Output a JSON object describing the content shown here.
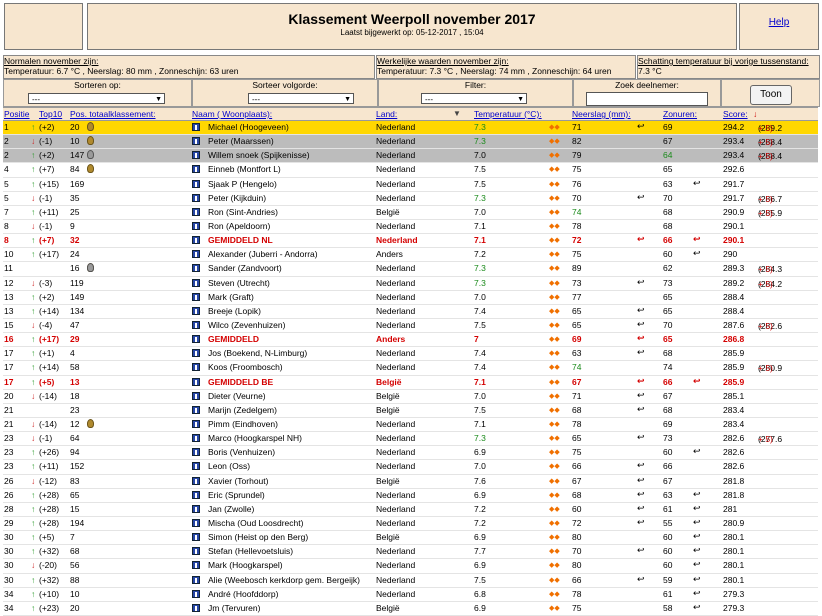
{
  "header": {
    "title": "Klassement Weerpoll november 2017",
    "updated": "Laatst bijgewerkt op: 05-12-2017 , 15:04",
    "help": "Help"
  },
  "info": {
    "normal_title": "Normalen november zijn:",
    "normal_values": "Temperatuur: 6.7 °C , Neerslag: 80 mm , Zonneschijn: 63 uren",
    "actual_title": "Werkelijke waarden november zijn:",
    "actual_values": "Temperatuur: 7.3 °C , Neerslag: 74 mm , Zonneschijn: 64 uren",
    "estimate_title": "Schatting temperatuur bij vorige tussenstand:",
    "estimate_value": "7.3 °C"
  },
  "controls": {
    "sort_on_label": "Sorteren op:",
    "sort_on_value": "---",
    "sort_order_label": "Sorteer volgorde:",
    "sort_order_value": "---",
    "filter_label": "Filter:",
    "filter_value": "---",
    "search_label": "Zoek deelnemer:",
    "search_value": "",
    "show_button": "Toon"
  },
  "columns": {
    "position": "Positie",
    "top10": "Top10",
    "total": "Pos. totaalklassement:",
    "name": "Naam ( Woonplaats):",
    "country": "Land:",
    "temperature": "Temperatuur (°C):",
    "precipitation": "Neerslag (mm):",
    "sun": "Zonuren:",
    "score": "Score:"
  },
  "colors": {
    "gold_row": "#ffd700",
    "silver_row": "#bcbcbc",
    "average_text": "#d40000",
    "good_value": "#1a8a1a",
    "panel": "#f7e6cf"
  },
  "rows": [
    {
      "rank": "1",
      "dir": "up",
      "move": "(+2)",
      "total": "20",
      "medals": [
        "gold"
      ],
      "name": "Michael (Hoogeveen)",
      "land": "Nederland",
      "temp": "7.3",
      "tg": true,
      "neer": "71",
      "ng": false,
      "nico": true,
      "zon": "69",
      "zg": false,
      "zico": false,
      "score": "294.2",
      "cmp": "(289.2 ",
      "plus": "+ 5)",
      "style": "gold"
    },
    {
      "rank": "2",
      "dir": "dn",
      "move": "(-1)",
      "total": "10",
      "medals": [
        "gold"
      ],
      "name": "Peter (Maarssen)",
      "land": "Nederland",
      "temp": "7.3",
      "tg": true,
      "neer": "82",
      "ng": false,
      "nico": false,
      "zon": "67",
      "zg": false,
      "zico": false,
      "score": "293.4",
      "cmp": "(288.4 ",
      "plus": "+ 5)",
      "style": "silver"
    },
    {
      "rank": "2",
      "dir": "up",
      "move": "(+2)",
      "total": "147",
      "medals": [
        "silver"
      ],
      "name": "Willem snoek (Spijkenisse)",
      "land": "Nederland",
      "temp": "7.0",
      "tg": false,
      "neer": "79",
      "ng": false,
      "nico": false,
      "zon": "64",
      "zg": true,
      "zico": false,
      "score": "293.4",
      "cmp": "(288.4 ",
      "plus": "+ 5)",
      "style": "silver"
    },
    {
      "rank": "4",
      "dir": "up",
      "move": "(+7)",
      "total": "84",
      "medals": [
        "gold"
      ],
      "name": "Einneb (Montfort L)",
      "land": "Nederland",
      "temp": "7.5",
      "tg": false,
      "neer": "75",
      "ng": false,
      "nico": false,
      "zon": "65",
      "zg": false,
      "zico": false,
      "score": "292.6",
      "cmp": "",
      "plus": "",
      "style": ""
    },
    {
      "rank": "5",
      "dir": "up",
      "move": "(+15)",
      "total": "169",
      "medals": [],
      "name": "Sjaak P (Hengelo)",
      "land": "Nederland",
      "temp": "7.5",
      "tg": false,
      "neer": "76",
      "ng": false,
      "nico": false,
      "zon": "63",
      "zg": false,
      "zico": true,
      "score": "291.7",
      "cmp": "",
      "plus": "",
      "style": ""
    },
    {
      "rank": "5",
      "dir": "dn",
      "move": "(-1)",
      "total": "35",
      "medals": [],
      "name": "Peter (Kijkduin)",
      "land": "Nederland",
      "temp": "7.3",
      "tg": true,
      "neer": "70",
      "ng": false,
      "nico": true,
      "zon": "70",
      "zg": false,
      "zico": false,
      "score": "291.7",
      "cmp": "(286.7 ",
      "plus": "+ 5)",
      "style": ""
    },
    {
      "rank": "7",
      "dir": "up",
      "move": "(+11)",
      "total": "25",
      "medals": [],
      "name": "Ron (Sint-Andries)",
      "land": "België",
      "temp": "7.0",
      "tg": false,
      "neer": "74",
      "ng": true,
      "nico": false,
      "zon": "68",
      "zg": false,
      "zico": false,
      "score": "290.9",
      "cmp": "(285.9 ",
      "plus": "+ 5)",
      "style": ""
    },
    {
      "rank": "8",
      "dir": "dn",
      "move": "(-1)",
      "total": "9",
      "medals": [],
      "name": "Ron (Apeldoorn)",
      "land": "Nederland",
      "temp": "7.1",
      "tg": false,
      "neer": "78",
      "ng": false,
      "nico": false,
      "zon": "68",
      "zg": false,
      "zico": false,
      "score": "290.1",
      "cmp": "",
      "plus": "",
      "style": ""
    },
    {
      "rank": "8",
      "dir": "up",
      "move": "(+7)",
      "total": "32",
      "medals": [],
      "name": "GEMIDDELD NL",
      "land": "Nederland",
      "temp": "7.1",
      "tg": false,
      "neer": "72",
      "ng": false,
      "nico": true,
      "zon": "66",
      "zg": false,
      "zico": true,
      "score": "290.1",
      "cmp": "",
      "plus": "",
      "style": "avg"
    },
    {
      "rank": "10",
      "dir": "up",
      "move": "(+17)",
      "total": "24",
      "medals": [],
      "name": "Alexander (Juberri - Andorra)",
      "land": "Anders",
      "temp": "7.2",
      "tg": false,
      "neer": "75",
      "ng": false,
      "nico": false,
      "zon": "60",
      "zg": false,
      "zico": true,
      "score": "290",
      "cmp": "",
      "plus": "",
      "style": ""
    },
    {
      "rank": "11",
      "dir": "",
      "move": "",
      "total": "16",
      "medals": [
        "gold",
        "silver"
      ],
      "name": "Sander (Zandvoort)",
      "land": "Nederland",
      "temp": "7.3",
      "tg": true,
      "neer": "89",
      "ng": false,
      "nico": false,
      "zon": "62",
      "zg": false,
      "zico": false,
      "score": "289.3",
      "cmp": "(284.3 ",
      "plus": "+ 5)",
      "style": ""
    },
    {
      "rank": "12",
      "dir": "dn",
      "move": "(-3)",
      "total": "119",
      "medals": [],
      "name": "Steven (Utrecht)",
      "land": "Nederland",
      "temp": "7.3",
      "tg": true,
      "neer": "73",
      "ng": false,
      "nico": true,
      "zon": "73",
      "zg": false,
      "zico": false,
      "score": "289.2",
      "cmp": "(284.2 ",
      "plus": "+ 5)",
      "style": ""
    },
    {
      "rank": "13",
      "dir": "up",
      "move": "(+2)",
      "total": "149",
      "medals": [],
      "name": "Mark (Graft)",
      "land": "Nederland",
      "temp": "7.0",
      "tg": false,
      "neer": "77",
      "ng": false,
      "nico": false,
      "zon": "65",
      "zg": false,
      "zico": false,
      "score": "288.4",
      "cmp": "",
      "plus": "",
      "style": ""
    },
    {
      "rank": "13",
      "dir": "up",
      "move": "(+14)",
      "total": "134",
      "medals": [],
      "name": "Breeje (Lopik)",
      "land": "Nederland",
      "temp": "7.4",
      "tg": false,
      "neer": "65",
      "ng": false,
      "nico": true,
      "zon": "65",
      "zg": false,
      "zico": false,
      "score": "288.4",
      "cmp": "",
      "plus": "",
      "style": ""
    },
    {
      "rank": "15",
      "dir": "dn",
      "move": "(-4)",
      "total": "47",
      "medals": [],
      "name": "Wilco (Zevenhuizen)",
      "land": "Nederland",
      "temp": "7.5",
      "tg": false,
      "neer": "65",
      "ng": false,
      "nico": true,
      "zon": "70",
      "zg": false,
      "zico": false,
      "score": "287.6",
      "cmp": "(282.6 ",
      "plus": "+ 5)",
      "style": ""
    },
    {
      "rank": "16",
      "dir": "up",
      "move": "(+17)",
      "total": "29",
      "medals": [],
      "name": "GEMIDDELD",
      "land": "Anders",
      "temp": "7",
      "tg": false,
      "neer": "69",
      "ng": false,
      "nico": true,
      "zon": "65",
      "zg": false,
      "zico": false,
      "score": "286.8",
      "cmp": "",
      "plus": "",
      "style": "avg"
    },
    {
      "rank": "17",
      "dir": "up",
      "move": "(+1)",
      "total": "4",
      "medals": [],
      "name": "Jos (Boekend, N-Limburg)",
      "land": "Nederland",
      "temp": "7.4",
      "tg": false,
      "neer": "63",
      "ng": false,
      "nico": true,
      "zon": "68",
      "zg": false,
      "zico": false,
      "score": "285.9",
      "cmp": "",
      "plus": "",
      "style": ""
    },
    {
      "rank": "17",
      "dir": "up",
      "move": "(+14)",
      "total": "58",
      "medals": [],
      "name": "Koos (Froombosch)",
      "land": "Nederland",
      "temp": "7.4",
      "tg": false,
      "neer": "74",
      "ng": true,
      "nico": false,
      "zon": "74",
      "zg": false,
      "zico": false,
      "score": "285.9",
      "cmp": "(280.9 ",
      "plus": "+ 5)",
      "style": ""
    },
    {
      "rank": "17",
      "dir": "up",
      "move": "(+5)",
      "total": "13",
      "medals": [],
      "name": "GEMIDDELD BE",
      "land": "België",
      "temp": "7.1",
      "tg": false,
      "neer": "67",
      "ng": false,
      "nico": true,
      "zon": "66",
      "zg": false,
      "zico": true,
      "score": "285.9",
      "cmp": "",
      "plus": "",
      "style": "avg"
    },
    {
      "rank": "20",
      "dir": "dn",
      "move": "(-14)",
      "total": "18",
      "medals": [],
      "name": "Dieter (Veurne)",
      "land": "België",
      "temp": "7.0",
      "tg": false,
      "neer": "71",
      "ng": false,
      "nico": true,
      "zon": "67",
      "zg": false,
      "zico": false,
      "score": "285.1",
      "cmp": "",
      "plus": "",
      "style": ""
    },
    {
      "rank": "21",
      "dir": "",
      "move": "",
      "total": "23",
      "medals": [],
      "name": "Marijn (Zedelgem)",
      "land": "België",
      "temp": "7.5",
      "tg": false,
      "neer": "68",
      "ng": false,
      "nico": true,
      "zon": "68",
      "zg": false,
      "zico": false,
      "score": "283.4",
      "cmp": "",
      "plus": "",
      "style": ""
    },
    {
      "rank": "21",
      "dir": "dn",
      "move": "(-14)",
      "total": "12",
      "medals": [
        "gold"
      ],
      "name": "Pimm (Eindhoven)",
      "land": "Nederland",
      "temp": "7.1",
      "tg": false,
      "neer": "78",
      "ng": false,
      "nico": false,
      "zon": "69",
      "zg": false,
      "zico": false,
      "score": "283.4",
      "cmp": "",
      "plus": "",
      "style": ""
    },
    {
      "rank": "23",
      "dir": "dn",
      "move": "(-1)",
      "total": "64",
      "medals": [],
      "name": "Marco (Hoogkarspel NH)",
      "land": "Nederland",
      "temp": "7.3",
      "tg": true,
      "neer": "65",
      "ng": false,
      "nico": true,
      "zon": "73",
      "zg": false,
      "zico": false,
      "score": "282.6",
      "cmp": "(277.6 ",
      "plus": "+ 5)",
      "style": ""
    },
    {
      "rank": "23",
      "dir": "up",
      "move": "(+26)",
      "total": "94",
      "medals": [],
      "name": "Boris (Venhuizen)",
      "land": "Nederland",
      "temp": "6.9",
      "tg": false,
      "neer": "75",
      "ng": false,
      "nico": false,
      "zon": "60",
      "zg": false,
      "zico": true,
      "score": "282.6",
      "cmp": "",
      "plus": "",
      "style": ""
    },
    {
      "rank": "23",
      "dir": "up",
      "move": "(+11)",
      "total": "152",
      "medals": [],
      "name": "Leon (Oss)",
      "land": "Nederland",
      "temp": "7.0",
      "tg": false,
      "neer": "66",
      "ng": false,
      "nico": true,
      "zon": "66",
      "zg": false,
      "zico": false,
      "score": "282.6",
      "cmp": "",
      "plus": "",
      "style": ""
    },
    {
      "rank": "26",
      "dir": "dn",
      "move": "(-12)",
      "total": "83",
      "medals": [],
      "name": "Xavier (Torhout)",
      "land": "België",
      "temp": "7.6",
      "tg": false,
      "neer": "67",
      "ng": false,
      "nico": true,
      "zon": "67",
      "zg": false,
      "zico": false,
      "score": "281.8",
      "cmp": "",
      "plus": "",
      "style": ""
    },
    {
      "rank": "26",
      "dir": "up",
      "move": "(+28)",
      "total": "65",
      "medals": [],
      "name": "Eric (Sprundel)",
      "land": "Nederland",
      "temp": "6.9",
      "tg": false,
      "neer": "68",
      "ng": false,
      "nico": true,
      "zon": "63",
      "zg": false,
      "zico": true,
      "score": "281.8",
      "cmp": "",
      "plus": "",
      "style": ""
    },
    {
      "rank": "28",
      "dir": "up",
      "move": "(+28)",
      "total": "15",
      "medals": [],
      "name": "Jan (Zwolle)",
      "land": "Nederland",
      "temp": "7.2",
      "tg": false,
      "neer": "60",
      "ng": false,
      "nico": true,
      "zon": "61",
      "zg": false,
      "zico": true,
      "score": "281",
      "cmp": "",
      "plus": "",
      "style": ""
    },
    {
      "rank": "29",
      "dir": "up",
      "move": "(+28)",
      "total": "194",
      "medals": [],
      "name": "Mischa (Oud Loosdrecht)",
      "land": "Nederland",
      "temp": "7.2",
      "tg": false,
      "neer": "72",
      "ng": false,
      "nico": true,
      "zon": "55",
      "zg": false,
      "zico": true,
      "score": "280.9",
      "cmp": "",
      "plus": "",
      "style": ""
    },
    {
      "rank": "30",
      "dir": "up",
      "move": "(+5)",
      "total": "7",
      "medals": [],
      "name": "Simon (Heist op den Berg)",
      "land": "België",
      "temp": "6.9",
      "tg": false,
      "neer": "80",
      "ng": false,
      "nico": false,
      "zon": "60",
      "zg": false,
      "zico": true,
      "score": "280.1",
      "cmp": "",
      "plus": "",
      "style": ""
    },
    {
      "rank": "30",
      "dir": "up",
      "move": "(+32)",
      "total": "68",
      "medals": [],
      "name": "Stefan (Hellevoetsluis)",
      "land": "Nederland",
      "temp": "7.7",
      "tg": false,
      "neer": "70",
      "ng": false,
      "nico": true,
      "zon": "60",
      "zg": false,
      "zico": true,
      "score": "280.1",
      "cmp": "",
      "plus": "",
      "style": ""
    },
    {
      "rank": "30",
      "dir": "dn",
      "move": "(-20)",
      "total": "56",
      "medals": [],
      "name": "Mark (Hoogkarspel)",
      "land": "Nederland",
      "temp": "6.9",
      "tg": false,
      "neer": "80",
      "ng": false,
      "nico": false,
      "zon": "60",
      "zg": false,
      "zico": true,
      "score": "280.1",
      "cmp": "",
      "plus": "",
      "style": ""
    },
    {
      "rank": "30",
      "dir": "up",
      "move": "(+32)",
      "total": "88",
      "medals": [],
      "name": "Alie (Weebosch kerkdorp gem. Bergeijk)",
      "land": "Nederland",
      "temp": "7.5",
      "tg": false,
      "neer": "66",
      "ng": false,
      "nico": true,
      "zon": "59",
      "zg": false,
      "zico": true,
      "score": "280.1",
      "cmp": "",
      "plus": "",
      "style": ""
    },
    {
      "rank": "34",
      "dir": "up",
      "move": "(+10)",
      "total": "10",
      "medals": [],
      "name": "André (Hoofddorp)",
      "land": "Nederland",
      "temp": "6.8",
      "tg": false,
      "neer": "78",
      "ng": false,
      "nico": false,
      "zon": "61",
      "zg": false,
      "zico": true,
      "score": "279.3",
      "cmp": "",
      "plus": "",
      "style": ""
    },
    {
      "rank": "34",
      "dir": "up",
      "move": "(+23)",
      "total": "20",
      "medals": [],
      "name": "Jm (Tervuren)",
      "land": "België",
      "temp": "6.9",
      "tg": false,
      "neer": "75",
      "ng": false,
      "nico": false,
      "zon": "58",
      "zg": false,
      "zico": true,
      "score": "279.3",
      "cmp": "",
      "plus": "",
      "style": ""
    }
  ]
}
